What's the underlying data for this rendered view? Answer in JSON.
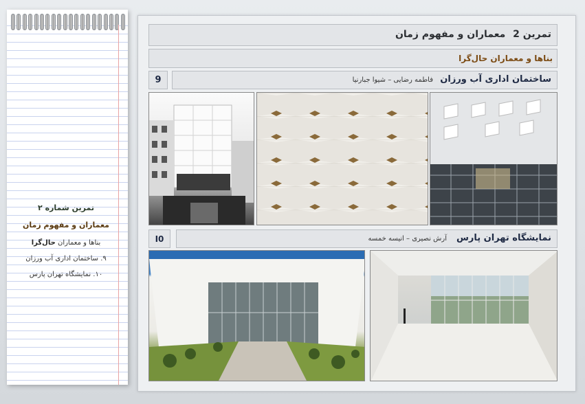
{
  "notebook": {
    "line1": "تمرین شماره ۲",
    "line2": "معماران و مفهوم زمان",
    "line3_prefix": "بناها و معماران ",
    "line3_bold": "حال‌گرا",
    "line4": "۹. ساختمان اداری آب ورزان",
    "line5": "۱۰. نمایشگاه تهران پارس"
  },
  "header": {
    "exercise_label": "تمرین",
    "exercise_number": "2",
    "title": "معماران و مفهوم زمان",
    "subtitle": "بناها و معماران حال‌گرا"
  },
  "project9": {
    "number": "9",
    "title": "ساختمان اداری آب ورزان",
    "architects": "فاطمه رضایی – شیوا جبارنیا"
  },
  "project10": {
    "number": "I0",
    "title": "نمایشگاه تهران پارس",
    "architects": "آرش نصیری – انیسه خمسه"
  },
  "colors": {
    "accent_brown": "#7b4a12",
    "title_navy": "#1f2a44"
  }
}
